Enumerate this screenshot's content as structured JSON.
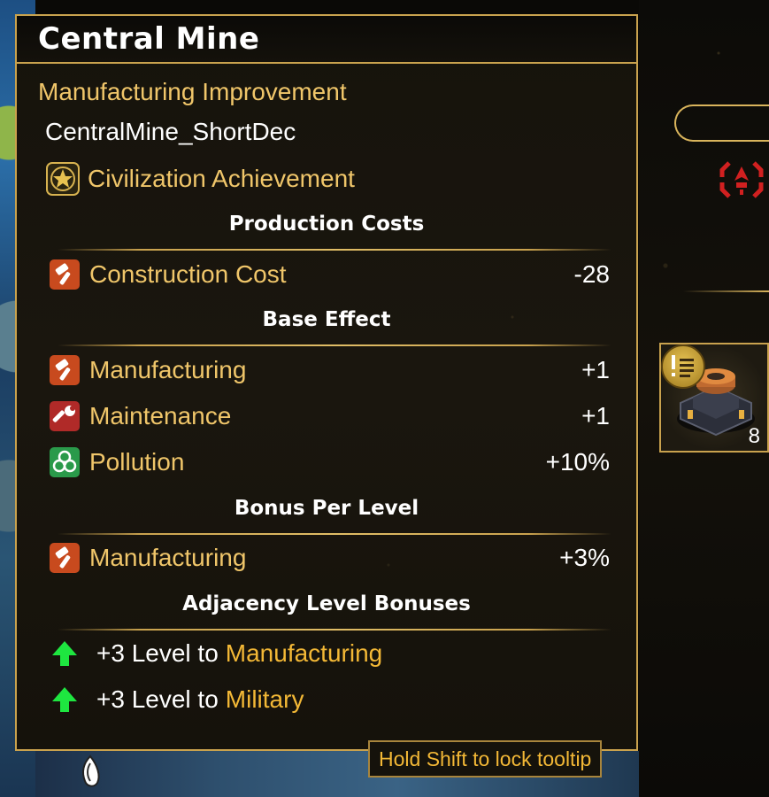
{
  "tooltip": {
    "title": "Central Mine",
    "subtitle": "Manufacturing Improvement",
    "description": "CentralMine_ShortDec",
    "achievement": {
      "icon": "star-icon",
      "label": "Civilization Achievement"
    },
    "sections": {
      "production_costs": {
        "header": "Production Costs",
        "rows": [
          {
            "icon": "hammer-icon",
            "label": "Construction Cost",
            "value": "-28"
          }
        ]
      },
      "base_effect": {
        "header": "Base Effect",
        "rows": [
          {
            "icon": "hammer-icon",
            "label": "Manufacturing",
            "value": "+1"
          },
          {
            "icon": "wrench-icon",
            "label": "Maintenance",
            "value": "+1"
          },
          {
            "icon": "biohazard-icon",
            "label": "Pollution",
            "value": "+10%"
          }
        ]
      },
      "bonus_per_level": {
        "header": "Bonus Per Level",
        "rows": [
          {
            "icon": "hammer-icon",
            "label": "Manufacturing",
            "value": "+3%"
          }
        ]
      },
      "adjacency": {
        "header": "Adjacency Level Bonuses",
        "rows": [
          {
            "icon": "green-arrow-up-icon",
            "prefix": "+3 Level to",
            "target": "Manufacturing"
          },
          {
            "icon": "green-arrow-up-icon",
            "prefix": "+3 Level to",
            "target": "Military"
          }
        ]
      }
    },
    "hint": "Hold Shift to lock tooltip"
  },
  "side_panel": {
    "building_count": "8"
  },
  "colors": {
    "gold_border": "#c9a24e",
    "label_gold": "#f0c66a",
    "target_orange": "#f3b836",
    "hammer_red": "#c84a1e",
    "wrench_red": "#b02a28",
    "bio_green": "#2a9a4a",
    "arrow_green": "#1ee640"
  }
}
